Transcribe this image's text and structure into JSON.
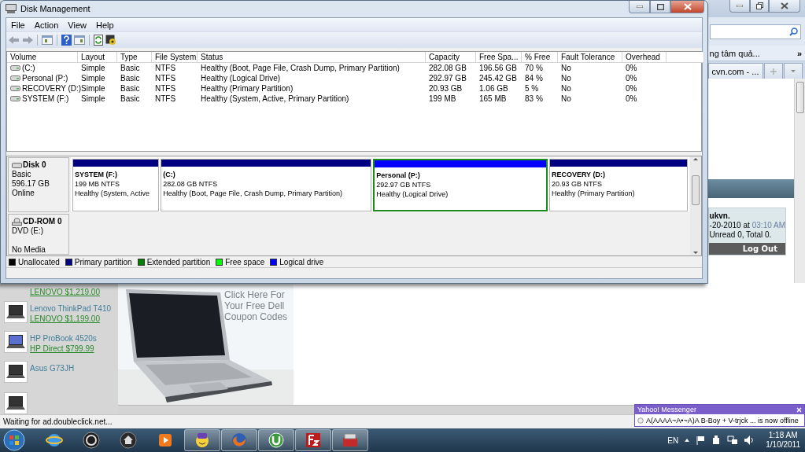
{
  "disk_management": {
    "title": "Disk Management",
    "menu": [
      "File",
      "Action",
      "View",
      "Help"
    ],
    "volumes_table": {
      "columns": [
        "Volume",
        "Layout",
        "Type",
        "File System",
        "Status",
        "Capacity",
        "Free Spa...",
        "% Free",
        "Fault Tolerance",
        "Overhead"
      ],
      "rows": [
        {
          "cells": [
            "(C:)",
            "Simple",
            "Basic",
            "NTFS",
            "Healthy (Boot, Page File, Crash Dump, Primary Partition)",
            "282.08 GB",
            "196.56 GB",
            "70 %",
            "No",
            "0%"
          ]
        },
        {
          "cells": [
            "Personal (P:)",
            "Simple",
            "Basic",
            "NTFS",
            "Healthy (Logical Drive)",
            "292.97 GB",
            "245.42 GB",
            "84 %",
            "No",
            "0%"
          ]
        },
        {
          "cells": [
            "RECOVERY (D:)",
            "Simple",
            "Basic",
            "NTFS",
            "Healthy (Primary Partition)",
            "20.93 GB",
            "1.06 GB",
            "5 %",
            "No",
            "0%"
          ]
        },
        {
          "cells": [
            "SYSTEM (F:)",
            "Simple",
            "Basic",
            "NTFS",
            "Healthy (System, Active, Primary Partition)",
            "199 MB",
            "165 MB",
            "83 %",
            "No",
            "0%"
          ]
        }
      ]
    },
    "disks": [
      {
        "kind": "disk",
        "name": "Disk 0",
        "info": [
          "Basic",
          "596.17 GB"
        ],
        "status": "Online",
        "partitions": [
          {
            "name": "SYSTEM  (F:)",
            "size": "199 MB NTFS",
            "status": "Healthy (System, Active",
            "kind": "primary",
            "selected": false
          },
          {
            "name": "(C:)",
            "size": "282.08 GB NTFS",
            "status": "Healthy (Boot, Page File, Crash Dump, Primary Partition)",
            "kind": "primary",
            "selected": false
          },
          {
            "name": "Personal  (P:)",
            "size": "292.97 GB NTFS",
            "status": "Healthy (Logical Drive)",
            "kind": "logical",
            "selected": true
          },
          {
            "name": "RECOVERY  (D:)",
            "size": "20.93 GB NTFS",
            "status": "Healthy (Primary Partition)",
            "kind": "primary",
            "selected": false
          }
        ]
      },
      {
        "kind": "cdrom",
        "name": "CD-ROM 0",
        "info": [
          "DVD (E:)"
        ],
        "status": "No Media"
      }
    ],
    "legend": [
      {
        "label": "Unallocated",
        "color": "#000000"
      },
      {
        "label": "Primary partition",
        "color": "#000080"
      },
      {
        "label": "Extended partition",
        "color": "#008000"
      },
      {
        "label": "Free space",
        "color": "#00ff00"
      },
      {
        "label": "Logical drive",
        "color": "#0000ff"
      }
    ]
  },
  "browser": {
    "bookmark": "ng tâm quả...",
    "bookmark_overflow": "»",
    "tab": "cvn.com - ...",
    "login": {
      "user": "ukvn.",
      "visit": "-20-2010 at",
      "visit_time": "03:10 AM",
      "messages": "Unread 0, Total 0.",
      "logout": "Log Out"
    },
    "products": [
      {
        "price": "LENOVO $1,219.00"
      },
      {
        "name": "Lenovo ThinkPad T410",
        "price": "LENOVO $1,199.00"
      },
      {
        "name": "HP ProBook 4520s",
        "price": "HP Direct $799.99"
      },
      {
        "name": "Asus G73JH"
      }
    ],
    "ad_text": "Click Here For Your Free Dell Coupon Codes",
    "status": "Waiting for ad.doubleclick.net..."
  },
  "messenger_alert": {
    "title": "Yahoo! Messenger",
    "message": "A(AAAA~A•~A)A B-Boy + V-trjck ... is now offline"
  },
  "taskbar": {
    "apps": [
      {
        "kind": "ie",
        "running": false
      },
      {
        "kind": "hp",
        "running": false
      },
      {
        "kind": "home",
        "running": false
      },
      {
        "kind": "media",
        "running": false
      },
      {
        "kind": "yahoo",
        "running": true
      },
      {
        "kind": "firefox",
        "running": true
      },
      {
        "kind": "torrent",
        "running": true
      },
      {
        "kind": "ftp",
        "running": true
      },
      {
        "kind": "toolbox",
        "running": true
      }
    ],
    "language": "EN",
    "time": "1:18 AM",
    "date": "1/10/2011"
  }
}
